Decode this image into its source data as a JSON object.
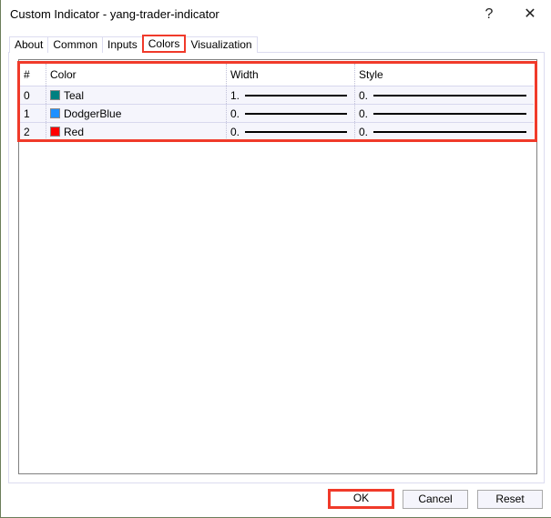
{
  "window": {
    "title": "Custom Indicator - yang-trader-indicator",
    "help": "?",
    "close": "✕"
  },
  "tabs": [
    {
      "label": "About"
    },
    {
      "label": "Common"
    },
    {
      "label": "Inputs"
    },
    {
      "label": "Colors",
      "active": true
    },
    {
      "label": "Visualization"
    }
  ],
  "table": {
    "headers": [
      "#",
      "Color",
      "Width",
      "Style"
    ],
    "rows": [
      {
        "index": "0",
        "color_name": "Teal",
        "color": "#008080",
        "width": "1.",
        "style": "0."
      },
      {
        "index": "1",
        "color_name": "DodgerBlue",
        "color": "#1E90FF",
        "width": "0.",
        "style": "0."
      },
      {
        "index": "2",
        "color_name": "Red",
        "color": "#FF0000",
        "width": "0.",
        "style": "0."
      }
    ]
  },
  "buttons": {
    "ok": "OK",
    "cancel": "Cancel",
    "reset": "Reset"
  }
}
